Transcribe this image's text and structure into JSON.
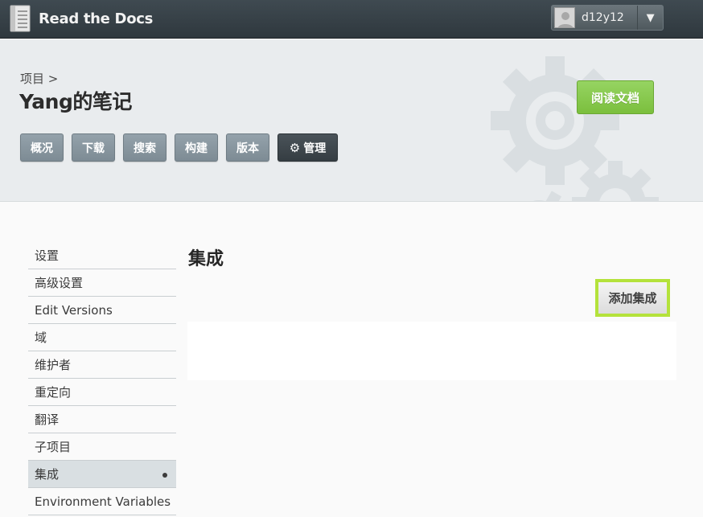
{
  "header": {
    "brand_name": "Read the Docs",
    "user": {
      "username": "d12y12",
      "caret": "▼"
    }
  },
  "project": {
    "breadcrumb": "项目 >",
    "title": "Yang的笔记",
    "read_docs_label": "阅读文档",
    "nav": [
      {
        "label": "概况"
      },
      {
        "label": "下载"
      },
      {
        "label": "搜索"
      },
      {
        "label": "构建"
      },
      {
        "label": "版本"
      },
      {
        "label": "管理",
        "icon": "gear-icon",
        "active": true
      }
    ]
  },
  "sidebar": {
    "items": [
      {
        "label": "设置"
      },
      {
        "label": "高级设置"
      },
      {
        "label": "Edit Versions"
      },
      {
        "label": "域"
      },
      {
        "label": "维护者"
      },
      {
        "label": "重定向"
      },
      {
        "label": "翻译"
      },
      {
        "label": "子项目"
      },
      {
        "label": "集成",
        "active": true
      },
      {
        "label": "Environment Variables"
      }
    ]
  },
  "main": {
    "title": "集成",
    "add_button_label": "添加集成",
    "highlight_color": "#b4e23b"
  },
  "colors": {
    "topbar": "#343d43",
    "primary_green": "#85c84a",
    "nav_button": "#8896a0",
    "nav_button_active": "#3d464b"
  }
}
